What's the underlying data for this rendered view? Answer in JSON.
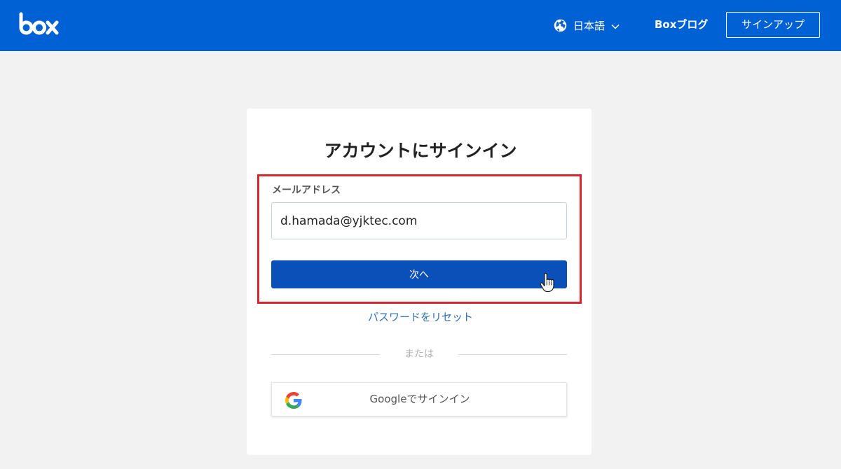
{
  "header": {
    "language_label": "日本語",
    "blog_label": "Boxブログ",
    "signup_label": "サインアップ",
    "brand_color": "#0061d5"
  },
  "signin": {
    "title": "アカウントにサインイン",
    "email_label": "メールアドレス",
    "email_value": "d.hamada@yjktec.com",
    "next_label": "次へ",
    "reset_password_label": "パスワードをリセット",
    "or_label": "または",
    "google_label": "Googleでサインイン",
    "highlight_color": "#d9262e"
  },
  "icons": {
    "logo": "box-logo",
    "language": "globe-icon",
    "language_toggle": "chevron-down-icon",
    "google": "google-g-icon",
    "pointer": "hand-pointer-cursor-icon"
  }
}
